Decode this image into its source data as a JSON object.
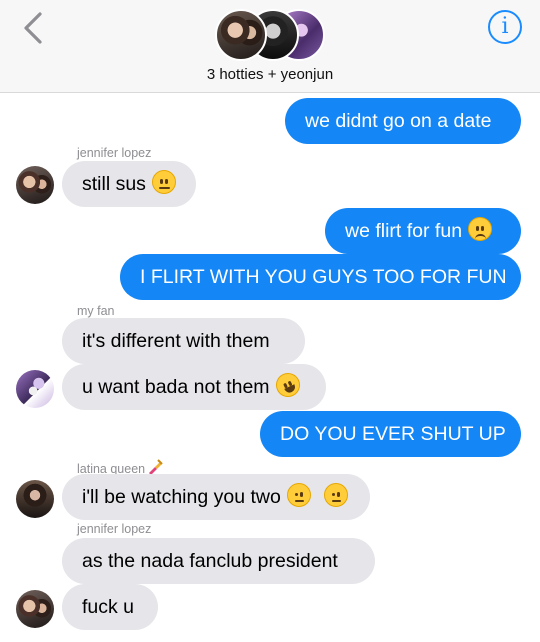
{
  "header": {
    "title": "3 hotties + yeonjun",
    "back_icon": "chevron-left-icon",
    "info_icon": "info-icon",
    "info_glyph": "i",
    "accent": "#1a8cff"
  },
  "colors": {
    "outgoing": "#1486f5",
    "incoming": "#e5e5ea",
    "sender_label": "#8e8e93"
  },
  "messages": {
    "m1": {
      "text": "we didnt go on a date"
    },
    "m2": {
      "sender": "jennifer lopez",
      "text": "still sus",
      "emoji": "neutral-face"
    },
    "m3": {
      "text": "we flirt for fun",
      "emoji": "frowning-face"
    },
    "m4": {
      "text": "I FLIRT WITH YOU GUYS TOO FOR FUN"
    },
    "m5": {
      "sender": "my fan",
      "text": "it's different with them"
    },
    "m6": {
      "text": "u want bada not them",
      "emoji": "rolling-laughing-face"
    },
    "m7": {
      "text": "DO YOU EVER SHUT UP"
    },
    "m8": {
      "sender": "latina queen",
      "sender_emoji": "nail-polish",
      "text": "i'll be watching you two",
      "emoji": "raised-eyebrow-face"
    },
    "m9": {
      "sender": "jennifer lopez",
      "text": "as the nada fanclub president"
    },
    "m10": {
      "text": "fuck u"
    }
  }
}
